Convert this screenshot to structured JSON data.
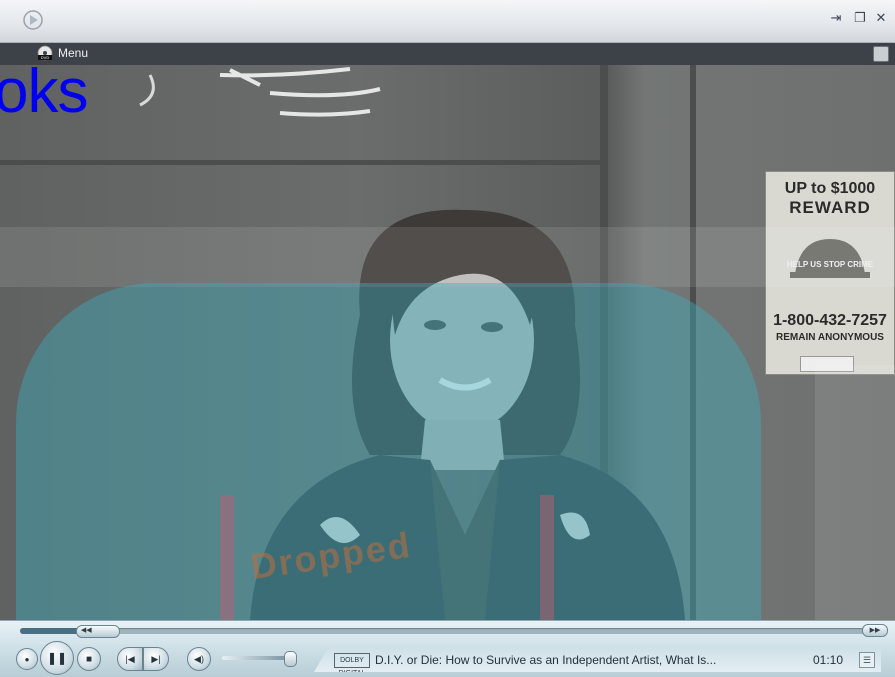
{
  "titlebar": {
    "logo_icon": "media-player-logo-icon",
    "buttons": [
      {
        "name": "pin-button",
        "glyph": "⇥"
      },
      {
        "name": "restore-button",
        "glyph": "❐"
      },
      {
        "name": "close-button",
        "glyph": "✕"
      }
    ]
  },
  "menubar": {
    "dvd_icon": "dvd-icon",
    "menu_label": "Menu"
  },
  "video": {
    "overlay_text": "oks",
    "poster": {
      "line1": "UP to $1000",
      "line2": "REWARD",
      "line3": "HELP US STOP CRIME",
      "line4": "1-800-432-7257",
      "line5": "REMAIN ANONYMOUS"
    },
    "watermark": "Dropped"
  },
  "controls": {
    "seek_progress": 0.09,
    "volume_level": 0.95,
    "buttons": [
      {
        "name": "stop-icon-button",
        "glyph": "●"
      },
      {
        "name": "pause-button",
        "glyph": "❚❚"
      },
      {
        "name": "stop-button",
        "glyph": "■"
      },
      {
        "name": "previous-button",
        "glyph": "|◀"
      },
      {
        "name": "next-button",
        "glyph": "▶|"
      },
      {
        "name": "mute-button",
        "glyph": "◀)"
      }
    ],
    "rewind_label": "◀◀",
    "fastforward_label": "▶▶",
    "now_playing": {
      "dolby_label": "DOLBY DIGITAL",
      "title": "D.I.Y. or Die: How to Survive as an Independent Artist, What Is...",
      "time": "01:10"
    }
  }
}
